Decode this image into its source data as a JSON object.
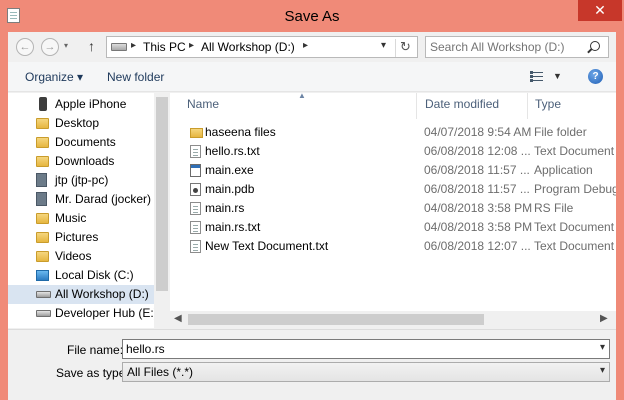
{
  "window": {
    "title": "Save As",
    "close_glyph": "✕"
  },
  "nav": {
    "back_glyph": "←",
    "forward_glyph": "→",
    "up_glyph": "↑"
  },
  "address": {
    "segments": [
      "This PC",
      "All Workshop (D:)"
    ],
    "refresh_glyph": "↻"
  },
  "search": {
    "placeholder": "Search All Workshop (D:)"
  },
  "toolbar": {
    "organize_label": "Organize ▾",
    "new_folder_label": "New folder",
    "help_glyph": "?"
  },
  "sidebar": {
    "items": [
      {
        "label": "Apple iPhone",
        "icon": "phone-icon"
      },
      {
        "label": "Desktop",
        "icon": "folder-icon"
      },
      {
        "label": "Documents",
        "icon": "folder-icon"
      },
      {
        "label": "Downloads",
        "icon": "folder-icon"
      },
      {
        "label": "jtp (jtp-pc)",
        "icon": "network-computer-icon"
      },
      {
        "label": "Mr. Darad (jocker)",
        "icon": "network-computer-icon"
      },
      {
        "label": "Music",
        "icon": "folder-icon"
      },
      {
        "label": "Pictures",
        "icon": "folder-icon"
      },
      {
        "label": "Videos",
        "icon": "folder-icon"
      },
      {
        "label": "Local Disk (C:)",
        "icon": "windows-drive-icon"
      },
      {
        "label": "All Workshop (D:)",
        "icon": "drive-icon",
        "selected": true
      },
      {
        "label": "Developer Hub (E:)",
        "icon": "drive-icon"
      }
    ]
  },
  "files": {
    "columns": {
      "name": "Name",
      "date": "Date modified",
      "type": "Type"
    },
    "rows": [
      {
        "name": "haseena files",
        "date": "04/07/2018 9:54 AM",
        "type": "File folder",
        "icon": "folder-icon"
      },
      {
        "name": "hello.rs.txt",
        "date": "06/08/2018 12:08 ...",
        "type": "Text Document",
        "icon": "text-document-icon"
      },
      {
        "name": "main.exe",
        "date": "06/08/2018 11:57 ...",
        "type": "Application",
        "icon": "application-icon"
      },
      {
        "name": "main.pdb",
        "date": "06/08/2018 11:57 ...",
        "type": "Program Debug D",
        "icon": "debug-file-icon"
      },
      {
        "name": "main.rs",
        "date": "04/08/2018 3:58 PM",
        "type": "RS File",
        "icon": "file-icon"
      },
      {
        "name": "main.rs.txt",
        "date": "04/08/2018 3:58 PM",
        "type": "Text Document",
        "icon": "text-document-icon"
      },
      {
        "name": "New Text Document.txt",
        "date": "06/08/2018 12:07 ...",
        "type": "Text Document",
        "icon": "text-document-icon"
      }
    ]
  },
  "form": {
    "filename_label": "File name:",
    "filename_value": "hello.rs",
    "savetype_label": "Save as type:",
    "savetype_value": "All Files  (*.*)"
  },
  "colors": {
    "titlebar": "#f08a78",
    "close_button": "#c7372a",
    "selection": "#d9e4f1"
  }
}
